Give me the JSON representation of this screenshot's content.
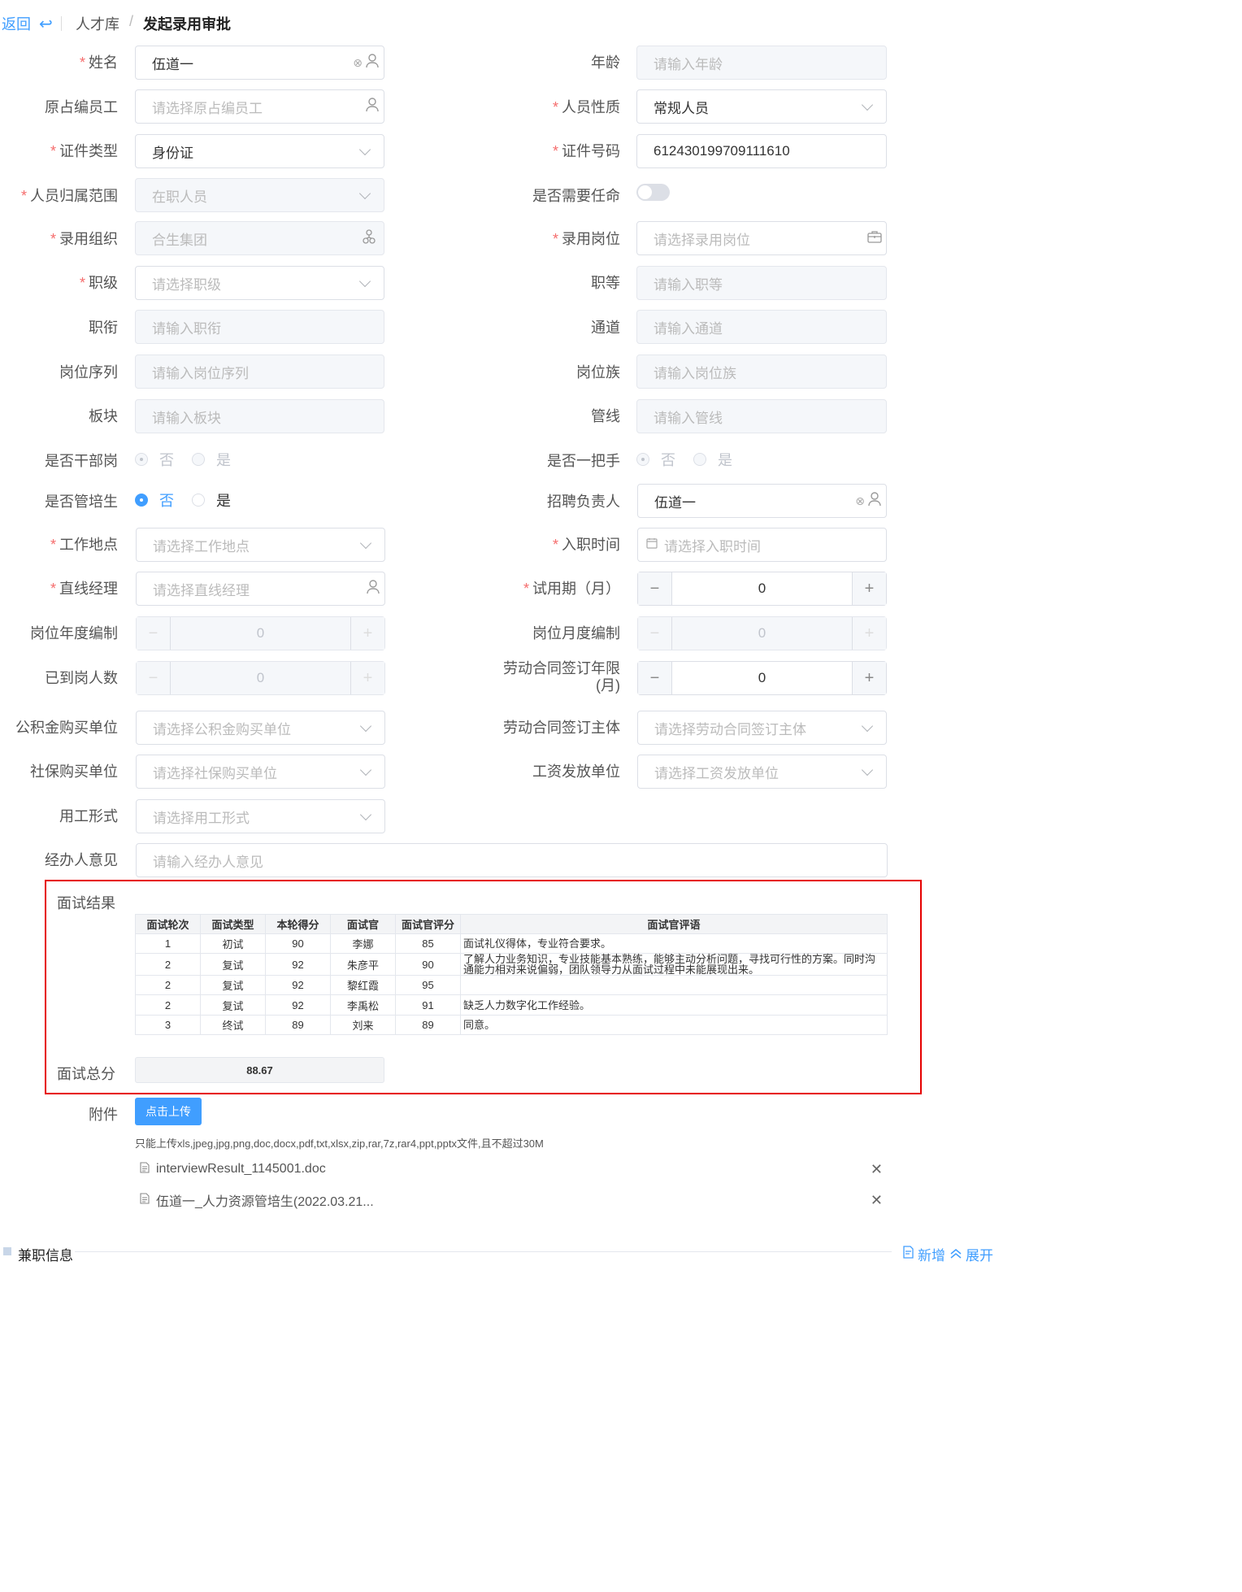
{
  "header": {
    "back_label": "返回",
    "breadcrumb_root": "人才库",
    "breadcrumb_sep": "/",
    "breadcrumb_current": "发起录用审批"
  },
  "form": {
    "name": {
      "label": "姓名",
      "value": "伍道一"
    },
    "age": {
      "label": "年龄",
      "placeholder": "请输入年龄"
    },
    "orig_staff": {
      "label": "原占编员工",
      "placeholder": "请选择原占编员工"
    },
    "person_type": {
      "label": "人员性质",
      "value": "常规人员"
    },
    "id_type": {
      "label": "证件类型",
      "value": "身份证"
    },
    "id_number": {
      "label": "证件号码",
      "value": "612430199709111610"
    },
    "scope": {
      "label": "人员归属范围",
      "value": "在职人员"
    },
    "need_appoint": {
      "label": "是否需要任命"
    },
    "org": {
      "label": "录用组织",
      "value": "合生集团"
    },
    "post": {
      "label": "录用岗位",
      "placeholder": "请选择录用岗位"
    },
    "grade": {
      "label": "职级",
      "placeholder": "请选择职级"
    },
    "rank": {
      "label": "职等",
      "placeholder": "请输入职等"
    },
    "title": {
      "label": "职衔",
      "placeholder": "请输入职衔"
    },
    "channel": {
      "label": "通道",
      "placeholder": "请输入通道"
    },
    "post_seq": {
      "label": "岗位序列",
      "placeholder": "请输入岗位序列"
    },
    "post_family": {
      "label": "岗位族",
      "placeholder": "请输入岗位族"
    },
    "sector": {
      "label": "板块",
      "placeholder": "请输入板块"
    },
    "line": {
      "label": "管线",
      "placeholder": "请输入管线"
    },
    "cadre": {
      "label": "是否干部岗",
      "opt_no": "否",
      "opt_yes": "是"
    },
    "top_leader": {
      "label": "是否一把手",
      "opt_no": "否",
      "opt_yes": "是"
    },
    "trainee": {
      "label": "是否管培生",
      "opt_no": "否",
      "opt_yes": "是"
    },
    "recruiter": {
      "label": "招聘负责人",
      "value": "伍道一"
    },
    "work_place": {
      "label": "工作地点",
      "placeholder": "请选择工作地点"
    },
    "entry_date": {
      "label": "入职时间",
      "placeholder": "请选择入职时间"
    },
    "manager": {
      "label": "直线经理",
      "placeholder": "请选择直线经理"
    },
    "probation": {
      "label": "试用期（月）",
      "value": "0"
    },
    "year_quota": {
      "label": "岗位年度编制",
      "value": "0"
    },
    "month_quota": {
      "label": "岗位月度编制",
      "value": "0"
    },
    "arrived": {
      "label": "已到岗人数",
      "value": "0"
    },
    "contract_term": {
      "label1": "劳动合同签订年限",
      "label2": "(月)",
      "value": "0"
    },
    "fund_unit": {
      "label": "公积金购买单位",
      "placeholder": "请选择公积金购买单位"
    },
    "contract_body": {
      "label": "劳动合同签订主体",
      "placeholder": "请选择劳动合同签订主体"
    },
    "social_unit": {
      "label": "社保购买单位",
      "placeholder": "请选择社保购买单位"
    },
    "salary_unit": {
      "label": "工资发放单位",
      "placeholder": "请选择工资发放单位"
    },
    "employ_form": {
      "label": "用工形式",
      "placeholder": "请选择用工形式"
    },
    "handler_opinion": {
      "label": "经办人意见",
      "placeholder": "请输入经办人意见"
    }
  },
  "interview": {
    "label": "面试结果",
    "headers": [
      "面试轮次",
      "面试类型",
      "本轮得分",
      "面试官",
      "面试官评分",
      "面试官评语"
    ],
    "rows": [
      [
        "1",
        "初试",
        "90",
        "李娜",
        "85",
        "面试礼仪得体，专业符合要求。"
      ],
      [
        "2",
        "复试",
        "92",
        "朱彦平",
        "90",
        "了解人力业务知识，专业技能基本熟练，能够主动分析问题，寻找可行性的方案。同时沟通能力相对来说偏弱，团队领导力从面试过程中未能展现出来。"
      ],
      [
        "2",
        "复试",
        "92",
        "黎红霞",
        "95",
        ""
      ],
      [
        "2",
        "复试",
        "92",
        "李禹松",
        "91",
        "缺乏人力数字化工作经验。"
      ],
      [
        "3",
        "终试",
        "89",
        "刘来",
        "89",
        "同意。"
      ]
    ],
    "total_label": "面试总分",
    "total_value": "88.67"
  },
  "attachment": {
    "label": "附件",
    "upload_label": "点击上传",
    "hint": "只能上传xls,jpeg,jpg,png,doc,docx,pdf,txt,xlsx,zip,rar,7z,rar4,ppt,pptx文件,且不超过30M",
    "files": [
      "interviewResult_1145001.doc",
      "伍道一_人力资源管培生(2022.03.21..."
    ]
  },
  "parttime": {
    "title": "兼职信息",
    "add_label": "新增",
    "expand_label": "展开"
  },
  "colors": {
    "primary": "#409eff",
    "required": "#f56c6c",
    "highlight_border": "#e60000"
  }
}
